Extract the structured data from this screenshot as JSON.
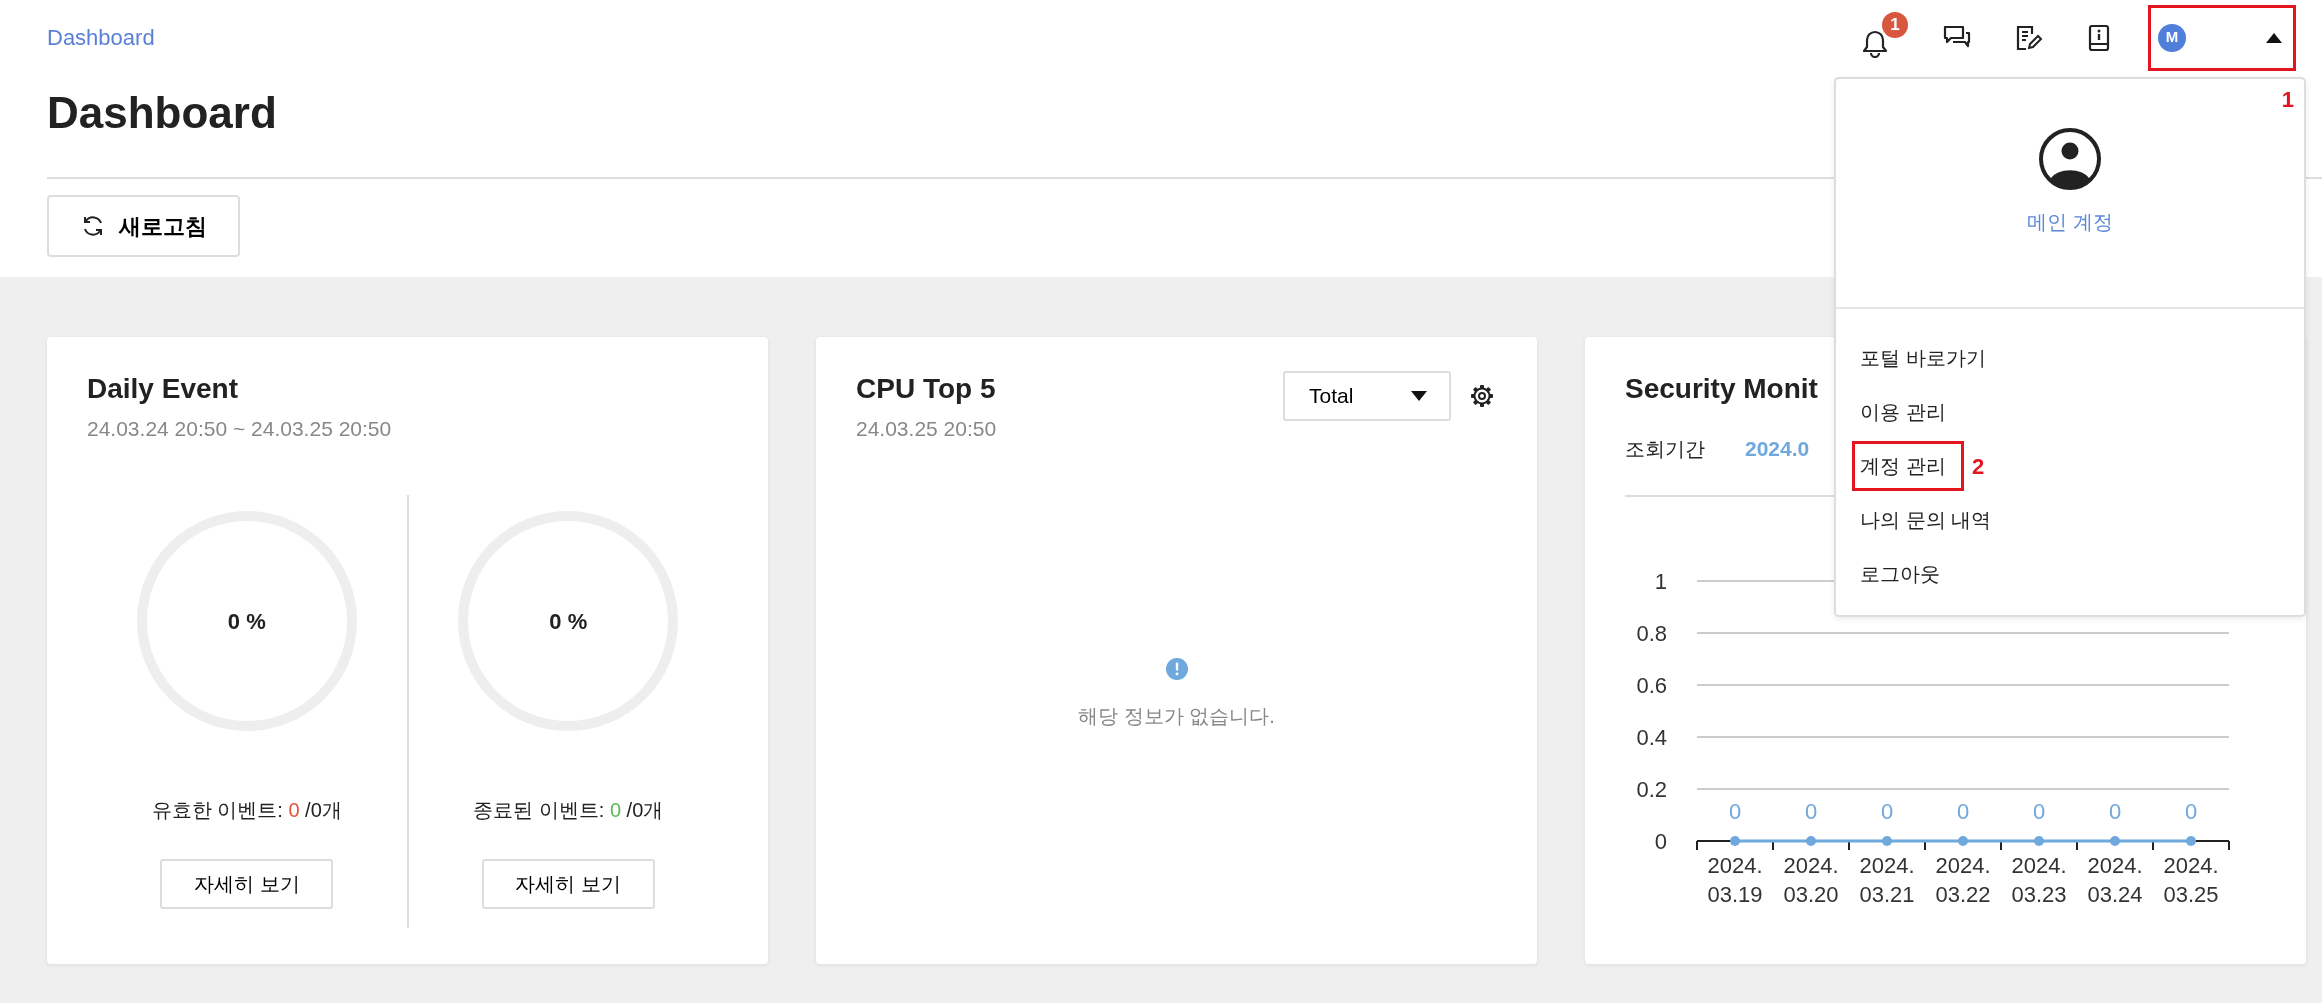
{
  "breadcrumb": "Dashboard",
  "page_title": "Dashboard",
  "header": {
    "notification_count": "1",
    "user_initial": "M",
    "user_annotation": "1"
  },
  "user_menu": {
    "account_label": "메인 계정",
    "items": [
      {
        "label": "포털 바로가기"
      },
      {
        "label": "이용 관리"
      },
      {
        "label": "계정 관리",
        "annotation": "2"
      },
      {
        "label": "나의 문의 내역"
      },
      {
        "label": "로그아웃"
      }
    ]
  },
  "refresh_button": "새로고침",
  "daily_event": {
    "title": "Daily Event",
    "period": "24.03.24 20:50 ~ 24.03.25 20:50",
    "gauges": [
      {
        "percent": "0 %",
        "label": "유효한 이벤트:",
        "count": "0",
        "total": "/0개",
        "color": "#e0533c",
        "button": "자세히 보기",
        "level": 0
      },
      {
        "percent": "0 %",
        "label": "종료된 이벤트:",
        "count": "0",
        "total": "/0개",
        "color": "#5cb85c",
        "button": "자세히 보기",
        "level": 0
      }
    ]
  },
  "cpu_top5": {
    "title": "CPU Top 5",
    "time": "24.03.25 20:50",
    "select": "Total",
    "empty_message": "해당 정보가 없습니다."
  },
  "security_monitor": {
    "title": "Security Monit",
    "period_label": "조회기간",
    "period_value": "2024.0",
    "chart_data": {
      "type": "line",
      "categories": [
        "2024. 03.19",
        "2024. 03.20",
        "2024. 03.21",
        "2024. 03.22",
        "2024. 03.23",
        "2024. 03.24",
        "2024. 03.25"
      ],
      "series": [
        {
          "color": "#6fa8dc",
          "values": [
            0,
            0,
            0,
            0,
            0,
            0,
            0
          ],
          "marker": true
        }
      ],
      "grid": true,
      "ylim": [
        0,
        1
      ],
      "yticks": [
        0,
        0.2,
        0.4,
        0.6,
        0.8,
        1
      ],
      "data_labels": true
    }
  }
}
